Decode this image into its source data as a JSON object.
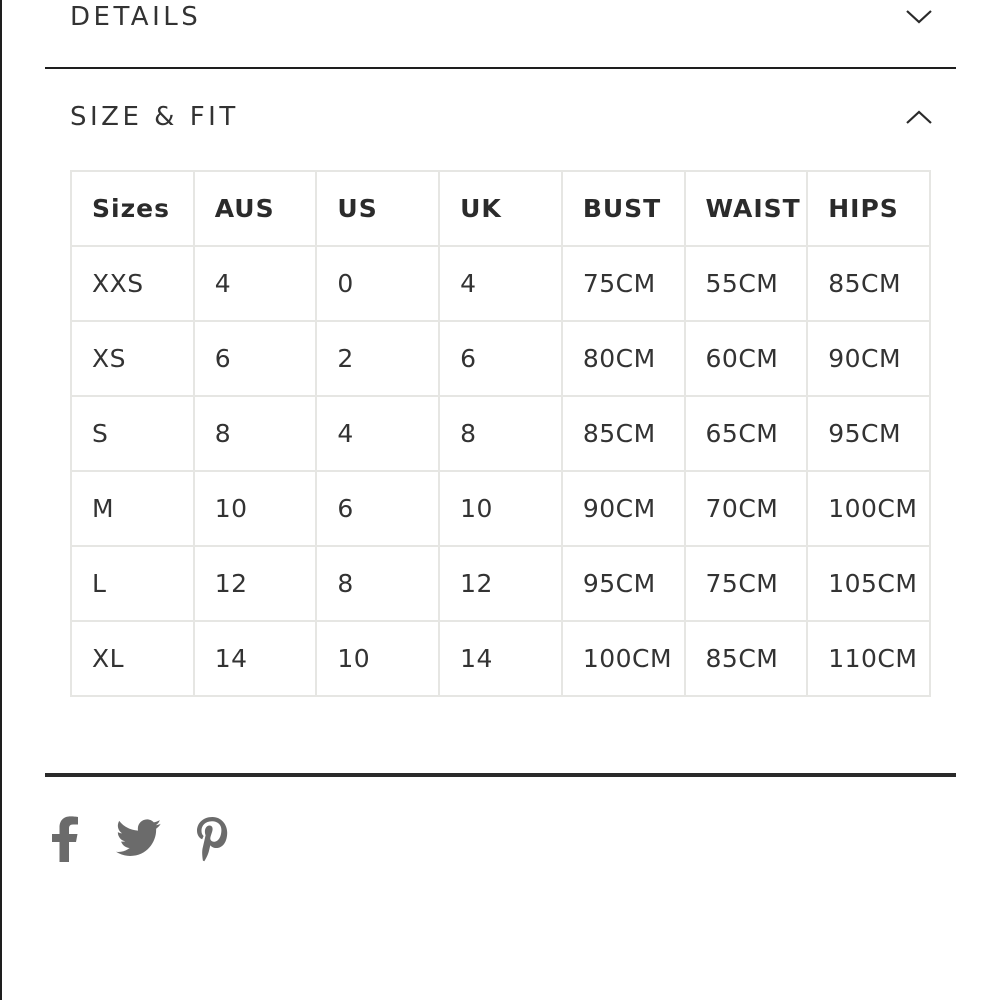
{
  "accordion": {
    "details_label": "DETAILS",
    "sizefit_label": "SIZE & FIT"
  },
  "size_table": {
    "headers": [
      "Sizes",
      "AUS",
      "US",
      "UK",
      "BUST",
      "WAIST",
      "HIPS"
    ],
    "rows": [
      [
        "XXS",
        "4",
        "0",
        "4",
        "75CM",
        "55CM",
        "85CM"
      ],
      [
        "XS",
        "6",
        "2",
        "6",
        "80CM",
        "60CM",
        "90CM"
      ],
      [
        "S",
        "8",
        "4",
        "8",
        "85CM",
        "65CM",
        "95CM"
      ],
      [
        "M",
        "10",
        "6",
        "10",
        "90CM",
        "70CM",
        "100CM"
      ],
      [
        "L",
        "12",
        "8",
        "12",
        "95CM",
        "75CM",
        "105CM"
      ],
      [
        "XL",
        "14",
        "10",
        "14",
        "100CM",
        "85CM",
        "110CM"
      ]
    ]
  },
  "share": {
    "icons": [
      "facebook-icon",
      "twitter-icon",
      "pinterest-icon"
    ],
    "icon_color": "#6b6b6b"
  },
  "colors": {
    "text": "#333333",
    "rule": "#1e1e1e",
    "table_border": "#e6e6e3"
  }
}
